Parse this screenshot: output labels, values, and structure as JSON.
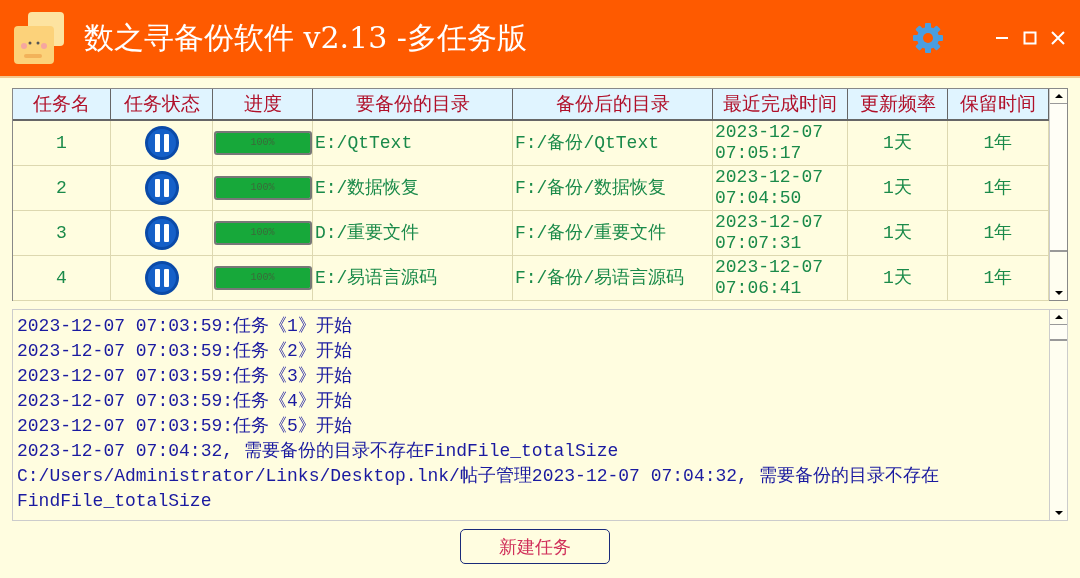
{
  "window": {
    "title": "数之寻备份软件 v2.13 -多任务版"
  },
  "table": {
    "columns": [
      "任务名",
      "任务状态",
      "进度",
      "要备份的目录",
      "备份后的目录",
      "最近完成时间",
      "更新频率",
      "保留时间"
    ],
    "rows": [
      {
        "name": "1",
        "running": true,
        "level": 1,
        "progress": "100%",
        "source": "E:/QtText",
        "target": "F:/备份/QtText",
        "last_done": "2023-12-07 07:05:17",
        "frequency": "1天",
        "retention": "1年"
      },
      {
        "name": "2",
        "running": true,
        "level": 1,
        "progress": "100%",
        "source": "E:/数据恢复",
        "target": "F:/备份/数据恢复",
        "last_done": "2023-12-07 07:04:50",
        "frequency": "1天",
        "retention": "1年"
      },
      {
        "name": "3",
        "running": true,
        "level": 1,
        "progress": "100%",
        "source": "D:/重要文件",
        "target": "F:/备份/重要文件",
        "last_done": "2023-12-07 07:07:31",
        "frequency": "1天",
        "retention": "1年"
      },
      {
        "name": "4",
        "running": true,
        "level": 1,
        "progress": "100%",
        "source": "E:/易语言源码",
        "target": "F:/备份/易语言源码",
        "last_done": "2023-12-07 07:06:41",
        "frequency": "1天",
        "retention": "1年"
      }
    ]
  },
  "log": [
    "2023-12-07 07:03:59:任务《1》开始",
    "2023-12-07 07:03:59:任务《2》开始",
    "2023-12-07 07:03:59:任务《3》开始",
    "2023-12-07 07:03:59:任务《4》开始",
    "2023-12-07 07:03:59:任务《5》开始",
    "2023-12-07 07:04:32, 需要备份的目录不存在FindFile_totalSize",
    "C:/Users/Administrator/Links/Desktop.lnk/帖子管理2023-12-07 07:04:32, 需要备份的目录不存在",
    "FindFile_totalSize"
  ],
  "buttons": [
    "新建任务"
  ]
}
